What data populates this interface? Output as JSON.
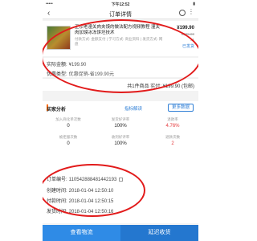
{
  "statusbar": {
    "signal": "••••• ",
    "time": "下午12:52",
    "battery": "▮"
  },
  "navbar": {
    "back": "‹",
    "title": "订单详情",
    "more": "⋮"
  },
  "product": {
    "name": "正宗老潼关肉夹馍的做法配方视频教程 潼关肉加馍冰冻饼坯技术",
    "spec": "付款方式: 金额支付 | 学习方式: 商业资料 | 发货方式: 网盘",
    "price": "¥199.90",
    "original_price": "¥299.00",
    "qty": "x1",
    "status": "已发货"
  },
  "payment": {
    "amount_label": "实际金额:",
    "amount_value": "¥199.90"
  },
  "discount": {
    "label": "优惠类型:",
    "value": "优惠促销-省199.90元"
  },
  "summary": {
    "text": "共1件商品  实付: ¥199.90 (包邮)"
  },
  "buyer_analysis": {
    "title": "买家分析",
    "link": "指标解读",
    "more_button": "更多数据",
    "stats": [
      {
        "label": "加入商化单次数",
        "value": "0",
        "red": false
      },
      {
        "label": "发货好评率",
        "value": "100%",
        "red": false
      },
      {
        "label": "退款率",
        "value": "4.76%",
        "red": true
      },
      {
        "label": "被拒服次数",
        "value": "0",
        "red": false
      },
      {
        "label": "收到好评率",
        "value": "100%",
        "red": false
      },
      {
        "label": "退款次数",
        "value": "2",
        "red": true
      }
    ]
  },
  "order_info": {
    "order_no_label": "订单编号:",
    "order_no": "110542888481442193",
    "created_label": "创建时间:",
    "created": "2018-01-04 12:50:10",
    "paid_label": "付款时间:",
    "paid": "2018-01-04 12:50:15",
    "shipped_label": "发货时间:",
    "shipped": "2018-01-04 12:50:16"
  },
  "bottom": {
    "left": "查看物流",
    "right": "延迟收货"
  },
  "colors": {
    "accent": "#2f8be6",
    "annotation": "#e21b1b",
    "negative": "#e4393c"
  }
}
